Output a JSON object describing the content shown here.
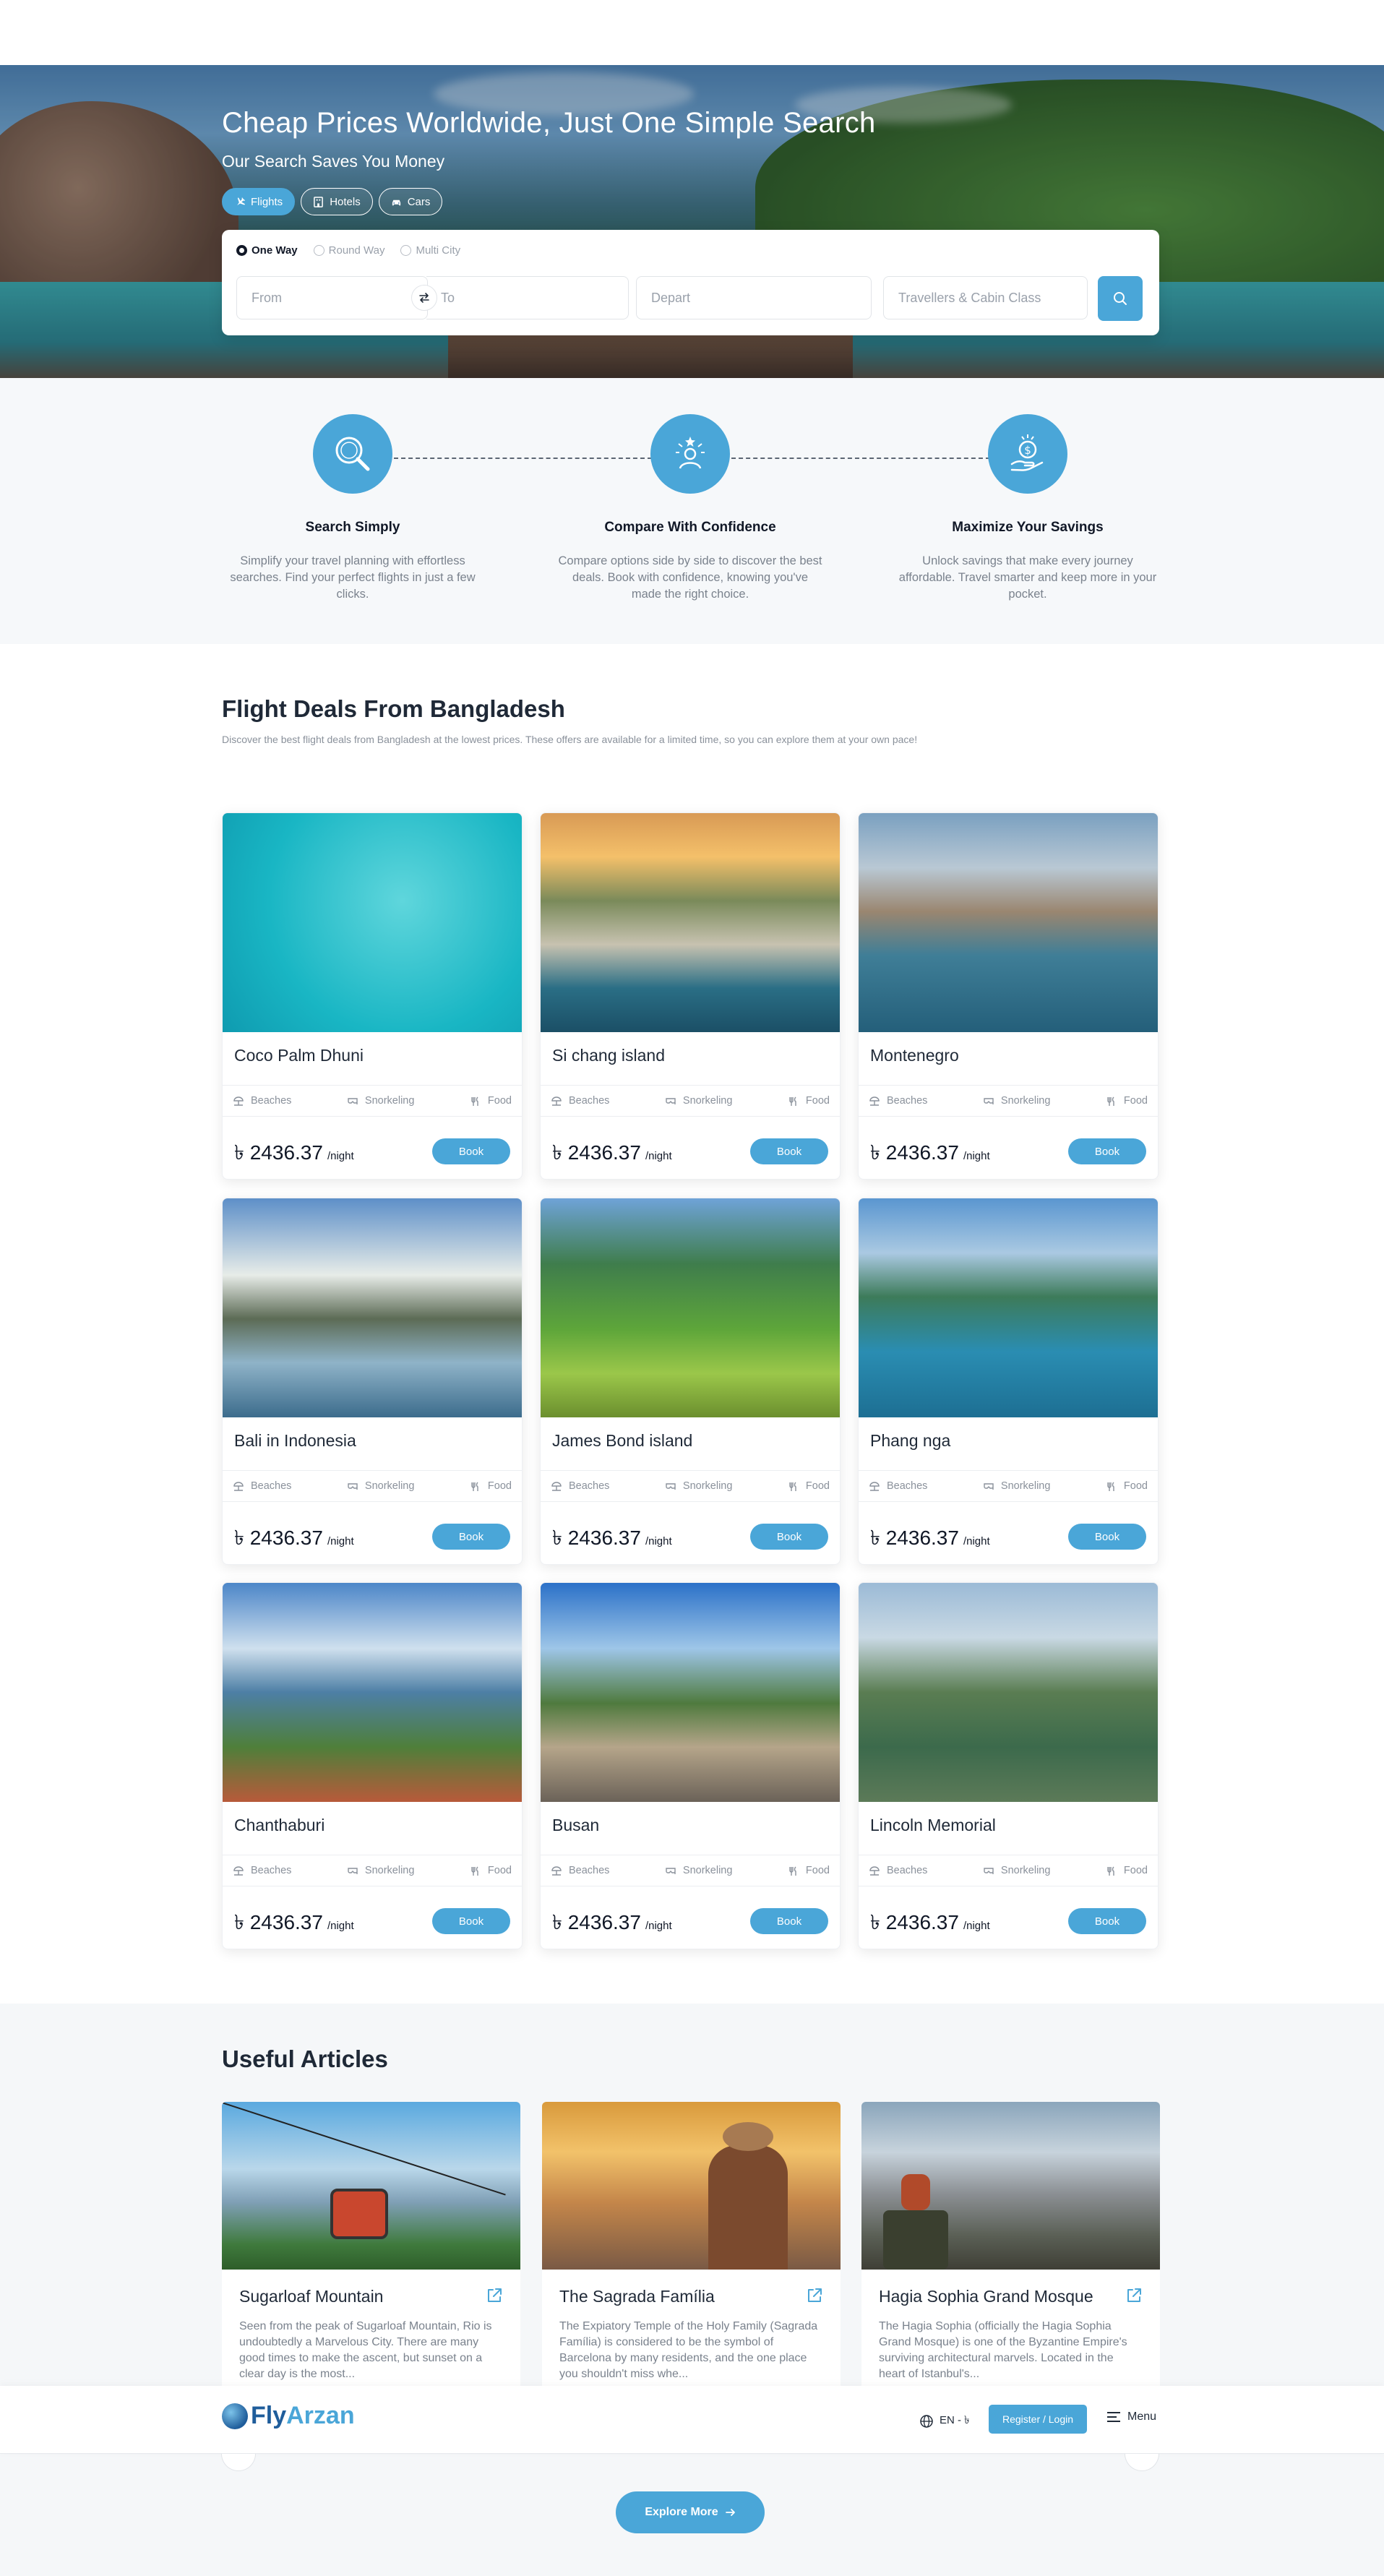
{
  "hero": {
    "title": "Cheap Prices Worldwide, Just One Simple Search",
    "subtitle": "Our Search Saves You Money",
    "tabs": [
      {
        "label": "Flights",
        "icon": "plane-icon",
        "active": true
      },
      {
        "label": "Hotels",
        "icon": "hotel-icon",
        "active": false
      },
      {
        "label": "Cars",
        "icon": "car-icon",
        "active": false
      }
    ]
  },
  "search": {
    "trip_types": [
      {
        "label": "One Way",
        "checked": true
      },
      {
        "label": "Round Way",
        "checked": false
      },
      {
        "label": "Multi City",
        "checked": false
      }
    ],
    "from_placeholder": "From",
    "to_placeholder": "To",
    "depart_placeholder": "Depart",
    "travellers_placeholder": "Travellers & Cabin Class"
  },
  "steps": [
    {
      "title": "Search Simply",
      "text": "Simplify your travel planning with effortless searches. Find your perfect flights in just a few clicks.",
      "icon": "magnifier-icon"
    },
    {
      "title": "Compare With Confidence",
      "text": "Compare options side by side to discover the best deals. Book with confidence, knowing you've made the right choice.",
      "icon": "person-star-icon"
    },
    {
      "title": "Maximize Your Savings",
      "text": "Unlock savings that make every journey affordable. Travel smarter and keep more in your pocket.",
      "icon": "coin-hand-icon"
    }
  ],
  "deals": {
    "title": "Flight Deals From Bangladesh",
    "subtitle": "Discover the best flight deals from Bangladesh at the lowest prices. These offers are available for a limited time, so you can explore them at your own pace!",
    "features": [
      "Beaches",
      "Snorkeling",
      "Food"
    ],
    "per_night": "/night",
    "book_label": "Book",
    "items": [
      {
        "name": "Coco Palm Dhuni",
        "price": "৳ 2436.37"
      },
      {
        "name": "Si chang island",
        "price": "৳ 2436.37"
      },
      {
        "name": "Montenegro",
        "price": "৳ 2436.37"
      },
      {
        "name": "Bali in Indonesia",
        "price": "৳ 2436.37"
      },
      {
        "name": "James Bond island",
        "price": "৳ 2436.37"
      },
      {
        "name": "Phang nga",
        "price": "৳ 2436.37"
      },
      {
        "name": "Chanthaburi",
        "price": "৳ 2436.37"
      },
      {
        "name": "Busan",
        "price": "৳ 2436.37"
      },
      {
        "name": "Lincoln Memorial",
        "price": "৳ 2436.37"
      }
    ]
  },
  "articles": {
    "title": "Useful Articles",
    "items": [
      {
        "title": "Sugarloaf Mountain",
        "text": "Seen from the peak of Sugarloaf Mountain, Rio is undoubtedly a Marvelous City. There are many good times to make the ascent, but sunset on a clear day is the most..."
      },
      {
        "title": "The Sagrada Família",
        "text": "The Expiatory Temple of the Holy Family (Sagrada Família) is considered to be the symbol of Barcelona by many residents, and the one place you shouldn't miss whe..."
      },
      {
        "title": "Hagia Sophia Grand Mosque",
        "text": "The Hagia Sophia (officially the Hagia Sophia Grand Mosque) is one of the Byzantine Empire's surviving architectural marvels. Located in the heart of Istanbul's..."
      }
    ],
    "explore_label": "Explore More"
  },
  "navbar": {
    "logo_fly": "Fly",
    "logo_arzan": "Arzan",
    "lang": "EN - ৳",
    "register_label": "Register / Login",
    "menu_label": "Menu"
  },
  "colors": {
    "accent": "#4aa6d8",
    "brand_dark": "#1f5d9b"
  }
}
